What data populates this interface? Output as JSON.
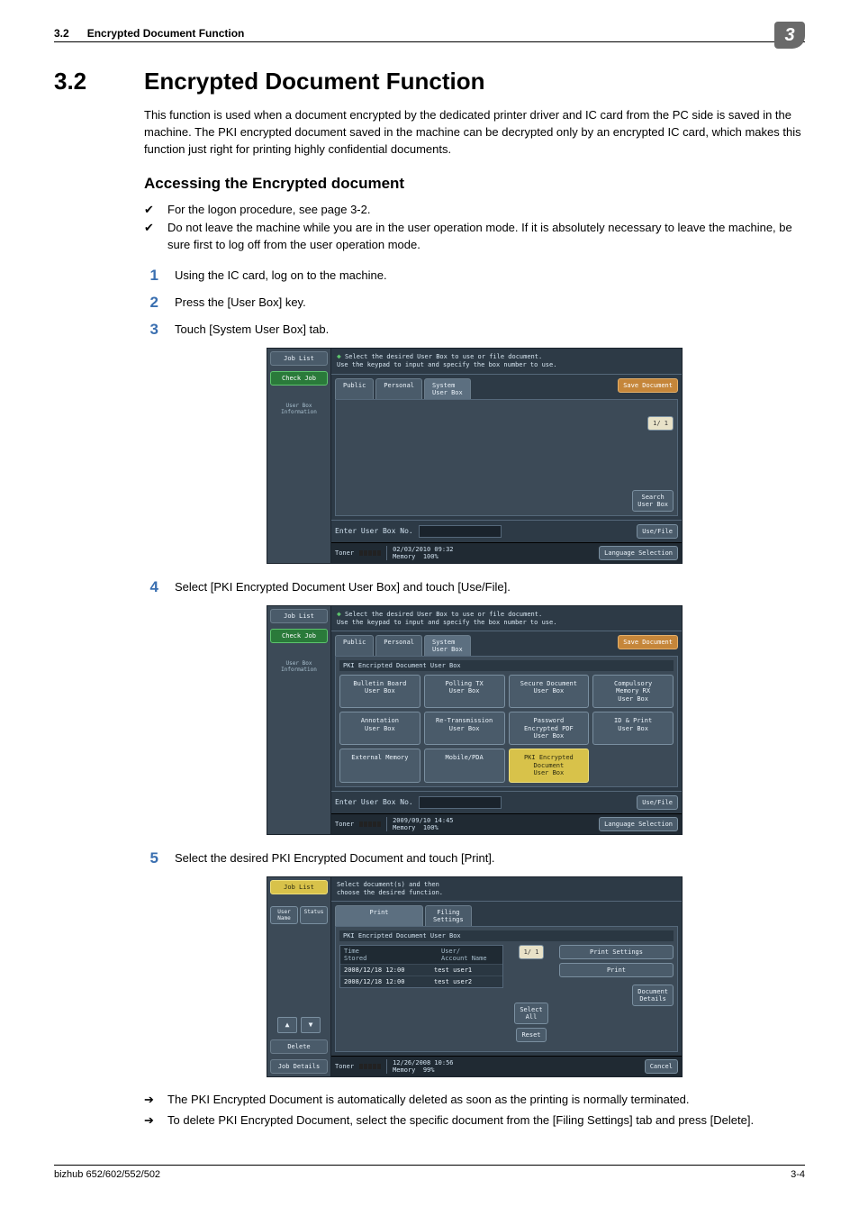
{
  "header": {
    "section_number": "3.2",
    "section_title_top": "Encrypted Document Function",
    "chapter_badge": "3"
  },
  "section": {
    "number": "3.2",
    "title": "Encrypted Document Function",
    "intro": "This function is used when a document encrypted by the dedicated printer driver and IC card from the PC side is saved in the machine. The PKI encrypted document saved in the machine can be decrypted only by an encrypted IC card, which makes this function just right for printing highly confidential documents."
  },
  "sub": {
    "title": "Accessing the Encrypted document",
    "checks": [
      "For the logon procedure, see page 3-2.",
      "Do not leave the machine while you are in the user operation mode. If it is absolutely necessary to leave the machine, be sure first to log off from the user operation mode."
    ],
    "steps": {
      "1": "Using the IC card, log on to the machine.",
      "2": "Press the [User Box] key.",
      "3": "Touch [System User Box] tab.",
      "4": "Select [PKI Encrypted Document User Box] and touch [Use/File].",
      "5": "Select the desired PKI Encrypted Document and touch [Print]."
    },
    "arrows": [
      "The PKI Encrypted Document is automatically deleted as soon as the printing is normally terminated.",
      "To delete PKI Encrypted Document, select the specific document from the [Filing Settings] tab and press [Delete]."
    ]
  },
  "panel_common": {
    "job_list": "Job List",
    "check_job": "Check Job",
    "user_box_info": "User Box\nInformation",
    "header_line1": "Select the desired User Box to use or file document.",
    "header_line2": "Use the keypad to input and specify the box number to use.",
    "public": "Public",
    "personal": "Personal",
    "system": "System\nUser Box",
    "save_document": "Save Document",
    "enter_box": "Enter User Box No.",
    "use_file": "Use/File",
    "search_box": "Search\nUser Box",
    "page_indicator": "1/  1",
    "toner": "Toner",
    "memory": "Memory",
    "mem_pct": "100%",
    "lang_sel": "Language Selection"
  },
  "panel1": {
    "datetime": "02/03/2010   09:32"
  },
  "panel2": {
    "stripe": "PKI Encripted Document User Box",
    "boxes": [
      "Bulletin Board\nUser Box",
      "Polling TX\nUser Box",
      "Secure Document\nUser Box",
      "Compulsory\nMemory RX\nUser Box",
      "Annotation\nUser Box",
      "Re-Transmission\nUser Box",
      "Password\nEncrypted PDF\nUser Box",
      "ID & Print\nUser Box",
      "External Memory",
      "Mobile/PDA",
      "PKI Encrypted\nDocument\nUser Box"
    ],
    "datetime": "2009/09/10   14:45"
  },
  "panel3": {
    "header_line1": "Select document(s) and then",
    "header_line2": "choose the desired function.",
    "print_tab": "Print",
    "filing_tab": "Filing\nSettings",
    "stripe": "PKI Encripted Document User Box",
    "col_time": "Time\nStored",
    "col_user": "User/\nAccount Name",
    "rows": [
      {
        "time": "2008/12/18 12:00",
        "name": "test user1"
      },
      {
        "time": "2008/12/18 12:00",
        "name": "test user2"
      }
    ],
    "select_all": "Select\nAll",
    "reset": "Reset",
    "print_settings": "Print Settings",
    "print_btn": "Print",
    "doc_details": "Document\nDetails",
    "cancel": "Cancel",
    "user_name": "User\nName",
    "status": "Status",
    "delete": "Delete",
    "job_details": "Job Details",
    "datetime": "12/26/2008   10:56",
    "mem_pct": "99%"
  },
  "footer": {
    "left": "bizhub 652/602/552/502",
    "right": "3-4"
  }
}
